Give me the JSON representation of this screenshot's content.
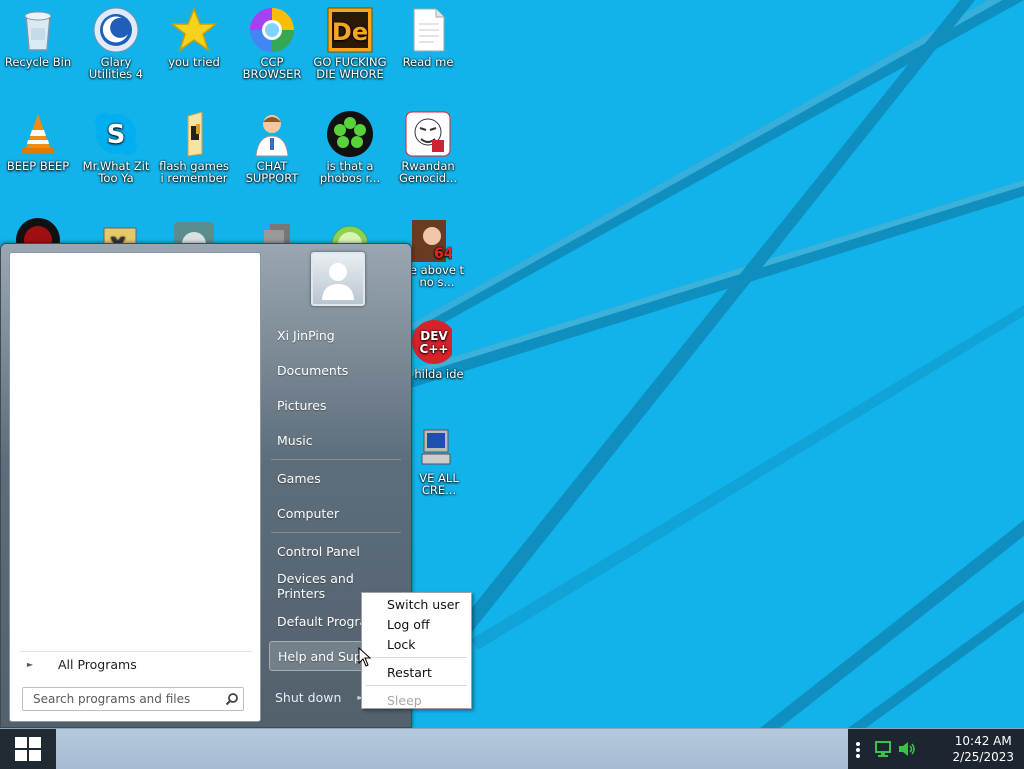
{
  "desktop": {
    "icons": [
      {
        "label": "Recycle Bin",
        "icon": "recycle-bin-icon"
      },
      {
        "label": "Glary Utilities 4",
        "icon": "glary-utilities-icon"
      },
      {
        "label": "you tried",
        "icon": "star-icon"
      },
      {
        "label": "CCP BROWSER",
        "icon": "browser-icon"
      },
      {
        "label": "GO FUCKING DIE WHORE",
        "icon": "de-app-icon"
      },
      {
        "label": "Read me",
        "icon": "text-file-icon"
      },
      {
        "label": "BEEP BEEP",
        "icon": "vlc-icon"
      },
      {
        "label": "Mr.What Zit Too Ya",
        "icon": "skype-icon"
      },
      {
        "label": "flash games i remember",
        "icon": "folder-icon"
      },
      {
        "label": "CHAT SUPPORT",
        "icon": "support-person-icon"
      },
      {
        "label": "is that a phobos r...",
        "icon": "icq-flower-icon"
      },
      {
        "label": "Rwandan Genocid...",
        "icon": "rage-comic-icon"
      },
      {
        "label": "e above t no s...",
        "icon": "portrait-icon"
      },
      {
        "label": "hilda ide",
        "icon": "dev-cpp-icon"
      },
      {
        "label": "VE ALL CRE...",
        "icon": "computer-icon"
      }
    ]
  },
  "start_menu": {
    "all_programs": "All Programs",
    "search_placeholder": "Search programs and files",
    "user_name": "Xi JinPing",
    "right_items": [
      "Documents",
      "Pictures",
      "Music",
      "Games",
      "Computer",
      "Control Panel",
      "Devices and Printers",
      "Default Programs",
      "Help and Support"
    ],
    "shutdown_label": "Shut down"
  },
  "shutdown_menu": {
    "items": [
      "Switch user",
      "Log off",
      "Lock",
      "Restart",
      "Sleep"
    ]
  },
  "taskbar": {
    "time": "10:42 AM",
    "date": "2/25/2023"
  },
  "colors": {
    "wallpaper": "#12b3ea",
    "wallpaper_stripe": "#0e8fbf"
  }
}
